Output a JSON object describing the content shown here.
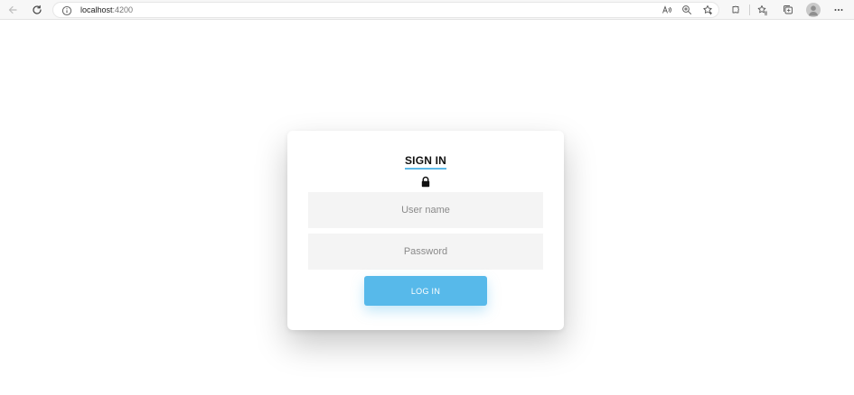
{
  "browser": {
    "url_host": "localhost",
    "url_port": ":4200",
    "icons": [
      "back-icon",
      "refresh-icon",
      "site-info-icon",
      "read-aloud-icon",
      "zoom-icon",
      "add-favorite-icon",
      "extensions-icon",
      "favorites-icon",
      "collections-icon",
      "profile-avatar",
      "more-menu-icon"
    ]
  },
  "login": {
    "title": "SIGN IN",
    "lock_icon": "lock-icon",
    "username_placeholder": "User name",
    "password_placeholder": "Password",
    "submit_label": "LOG IN"
  },
  "colors": {
    "accent": "#57b9ea",
    "field_bg": "#f4f4f4",
    "card_bg": "#ffffff"
  }
}
